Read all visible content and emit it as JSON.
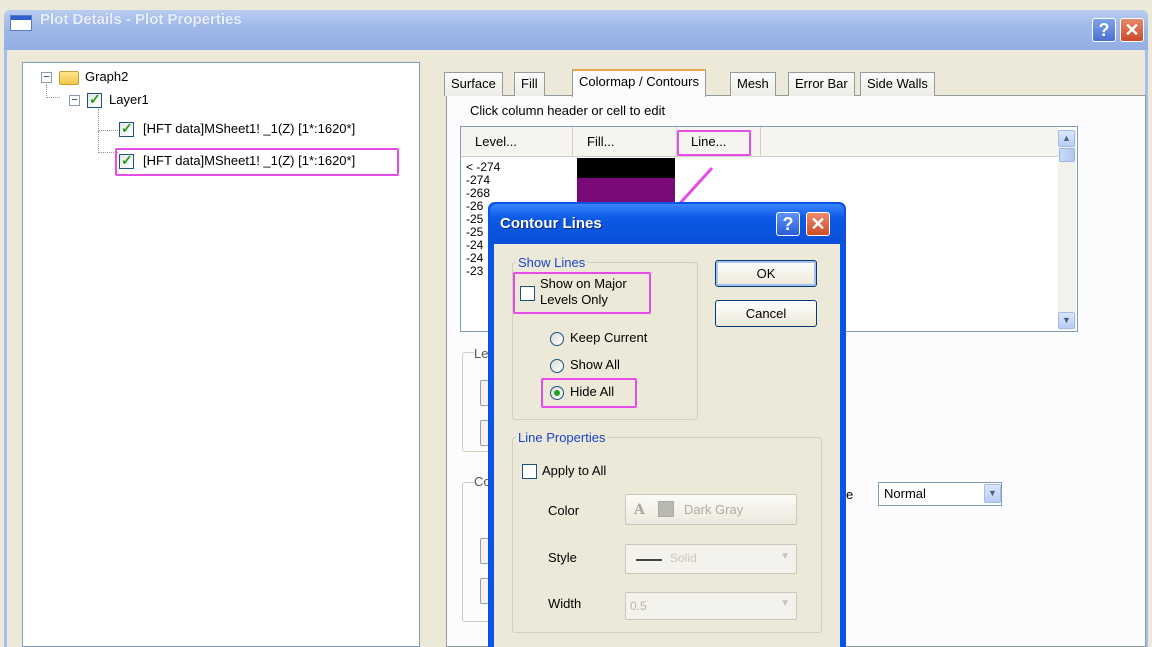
{
  "main_window": {
    "title": "Plot Details - Plot Properties",
    "help_label": "?",
    "close_label": "✕"
  },
  "tree": {
    "graph": "Graph2",
    "layer": "Layer1",
    "plots": [
      "[HFT data]MSheet1! _1(Z) [1*:1620*]",
      "[HFT data]MSheet1! _1(Z) [1*:1620*]"
    ]
  },
  "tabs": [
    "Surface",
    "Fill",
    "Colormap / Contours",
    "Mesh",
    "Error Bar",
    "Side Walls"
  ],
  "active_tab": "Colormap / Contours",
  "hint": "Click column header or cell to edit",
  "grid": {
    "headers": [
      "Level...",
      "Fill...",
      "Line..."
    ],
    "levels": [
      "< -274",
      "-274",
      "-268",
      "-26",
      "-25",
      "-25",
      "-24",
      "-24",
      "-23"
    ],
    "fill_colors": [
      "#000000",
      "#7a0a7a"
    ]
  },
  "left_group_label": "Le",
  "left_group_label2": "Co",
  "blend_select": {
    "value": "Normal",
    "label_fragment": "e"
  },
  "contour_dialog": {
    "title": "Contour Lines",
    "help_label": "?",
    "close_label": "✕",
    "show_lines_label": "Show Lines",
    "major_levels_label": "Show on Major\nLevels Only",
    "major_levels_line1": "Show on Major",
    "major_levels_line2": "Levels Only",
    "radios": [
      "Keep Current",
      "Show All",
      "Hide All"
    ],
    "selected_radio": "Hide All",
    "ok_label": "OK",
    "cancel_label": "Cancel",
    "line_properties_label": "Line Properties",
    "apply_to_all_label": "Apply to All",
    "color_label": "Color",
    "color_letter": "A",
    "color_value": "Dark Gray",
    "style_label": "Style",
    "style_value": "Solid",
    "width_label": "Width",
    "width_value": "0.5"
  },
  "colors": {
    "highlight": "#e64ce6",
    "dialog_title_blue": "#0a54e3",
    "fill_black": "#000000",
    "fill_purple": "#7a0a7a"
  }
}
